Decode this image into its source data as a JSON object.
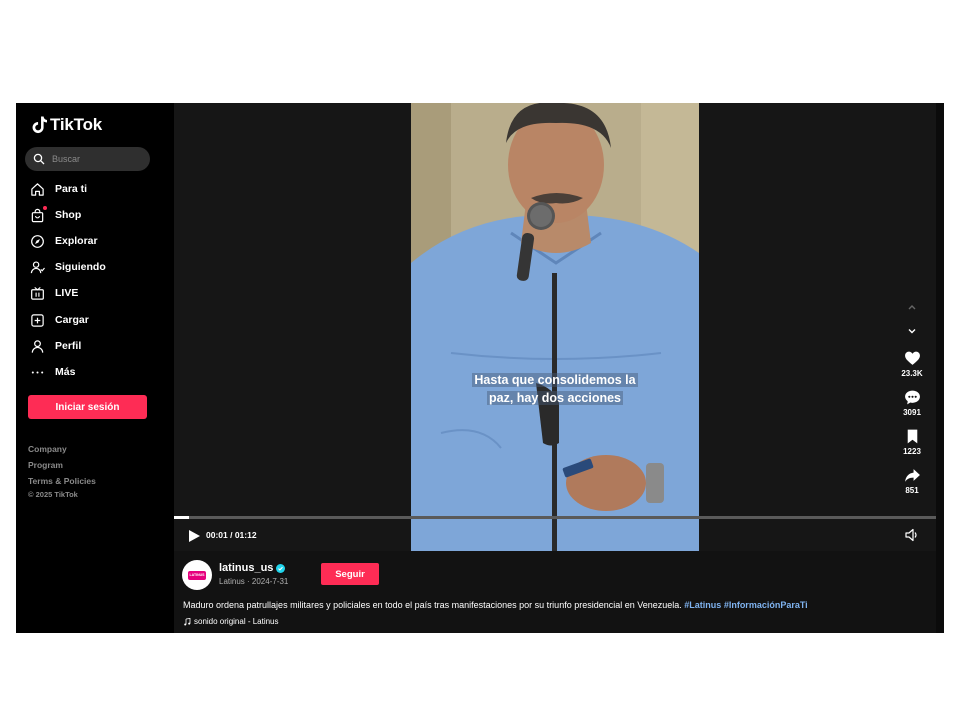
{
  "brand": {
    "name": "TikTok",
    "accent": "#fe2c55"
  },
  "search": {
    "placeholder": "Buscar"
  },
  "sidebar": {
    "items": [
      {
        "label": "Para ti",
        "icon": "home-icon"
      },
      {
        "label": "Shop",
        "icon": "shop-bag-icon"
      },
      {
        "label": "Explorar",
        "icon": "compass-icon"
      },
      {
        "label": "Siguiendo",
        "icon": "following-icon"
      },
      {
        "label": "LIVE",
        "icon": "live-tv-icon"
      },
      {
        "label": "Cargar",
        "icon": "upload-icon"
      },
      {
        "label": "Perfil",
        "icon": "profile-icon"
      },
      {
        "label": "Más",
        "icon": "more-icon"
      }
    ],
    "login_label": "Iniciar sesión",
    "footer_links": [
      "Company",
      "Program",
      "Terms & Policies"
    ],
    "copyright": "© 2025 TikTok"
  },
  "video": {
    "caption_line1": "Hasta que consolidemos la",
    "caption_line2": "paz, hay dos acciones",
    "time": "00:01 / 01:12",
    "progress": 0.02
  },
  "actions": {
    "likes": "23.3K",
    "comments": "3091",
    "saves": "1223",
    "shares": "851"
  },
  "author": {
    "username": "latinus_us",
    "meta": "Latinus · 2024-7-31",
    "avatar_text": "LATINUS",
    "follow_label": "Seguir"
  },
  "description": {
    "text": "Maduro ordena patrullajes militares y policiales en todo el país tras manifestaciones por su triunfo presidencial en Venezuela. ",
    "hashtag1": "#Latinus",
    "hashtag2": "#InformaciónParaTi"
  },
  "sound": "sonido original - Latinus"
}
